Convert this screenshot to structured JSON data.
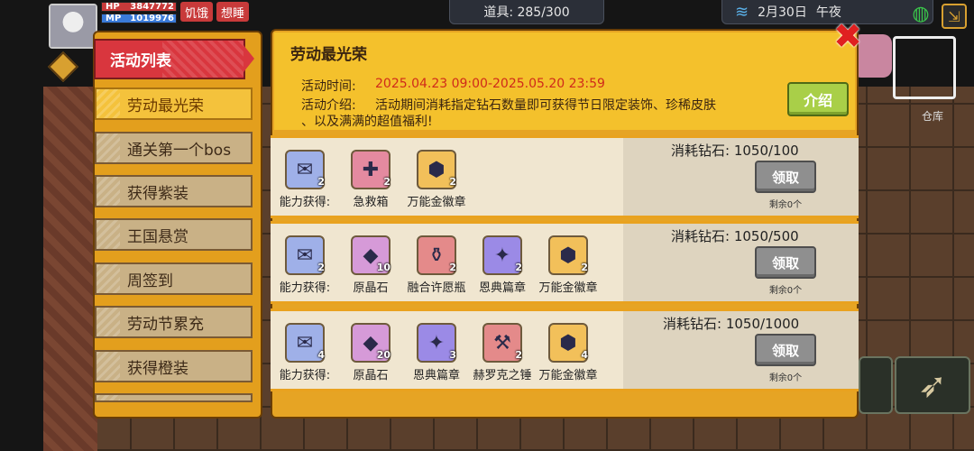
{
  "hud": {
    "hp_label": "HP",
    "hp_value": "3847772",
    "mp_label": "MP",
    "mp_value": "1019976",
    "status_hungry": "饥饿",
    "status_sleepy": "想睡",
    "items_label": "道具: 285/300",
    "date": "2月30日",
    "time_of_day": "午夜",
    "warehouse": "仓库"
  },
  "sidebar": {
    "header": "活动列表",
    "items": [
      {
        "label": "劳动最光荣"
      },
      {
        "label": "通关第一个bos"
      },
      {
        "label": "获得紫装"
      },
      {
        "label": "王国悬赏"
      },
      {
        "label": "周签到"
      },
      {
        "label": "劳动节累充"
      },
      {
        "label": "获得橙装"
      }
    ]
  },
  "event": {
    "title": "劳动最光荣",
    "time_label": "活动时间:",
    "time_value": "2025.04.23 09:00-2025.05.20 23:59",
    "intro_label": "活动介绍:",
    "intro_line1": "活动期间消耗指定钻石数量即可获得节日限定装饰、珍稀皮肤",
    "intro_line2": "、以及满满的超值福利!",
    "intro_button": "介绍"
  },
  "rewards": [
    {
      "cost": "消耗钻石: 1050/100",
      "button": "领取",
      "remain": "剩余0个",
      "items": [
        {
          "name": "能力获得:",
          "qty": "2",
          "icon": "scroll-icon",
          "color": "#9fb0e8"
        },
        {
          "name": "急救箱",
          "qty": "2",
          "icon": "first-aid-kit-icon",
          "color": "#e48aa0"
        },
        {
          "name": "万能金徽章",
          "qty": "2",
          "icon": "gold-badge-icon",
          "color": "#f2c05a"
        }
      ]
    },
    {
      "cost": "消耗钻石: 1050/500",
      "button": "领取",
      "remain": "剩余0个",
      "items": [
        {
          "name": "能力获得:",
          "qty": "2",
          "icon": "scroll-icon",
          "color": "#9fb0e8"
        },
        {
          "name": "原晶石",
          "qty": "10",
          "icon": "crystal-ore-icon",
          "color": "#d69ad8"
        },
        {
          "name": "融合许愿瓶",
          "qty": "2",
          "icon": "wish-bottle-icon",
          "color": "#e48a8a"
        },
        {
          "name": "恩典篇章",
          "qty": "2",
          "icon": "grace-card-icon",
          "color": "#9b8ae6"
        },
        {
          "name": "万能金徽章",
          "qty": "2",
          "icon": "gold-badge-icon",
          "color": "#f2c05a"
        }
      ]
    },
    {
      "cost": "消耗钻石: 1050/1000",
      "button": "领取",
      "remain": "剩余0个",
      "items": [
        {
          "name": "能力获得:",
          "qty": "4",
          "icon": "scroll-icon",
          "color": "#9fb0e8"
        },
        {
          "name": "原晶石",
          "qty": "20",
          "icon": "crystal-ore-icon",
          "color": "#d69ad8"
        },
        {
          "name": "恩典篇章",
          "qty": "3",
          "icon": "grace-card-icon",
          "color": "#9b8ae6"
        },
        {
          "name": "赫罗克之锤",
          "qty": "2",
          "icon": "hammer-icon",
          "color": "#e48a8a"
        },
        {
          "name": "万能金徽章",
          "qty": "4",
          "icon": "gold-badge-icon",
          "color": "#f2c05a"
        }
      ]
    }
  ]
}
